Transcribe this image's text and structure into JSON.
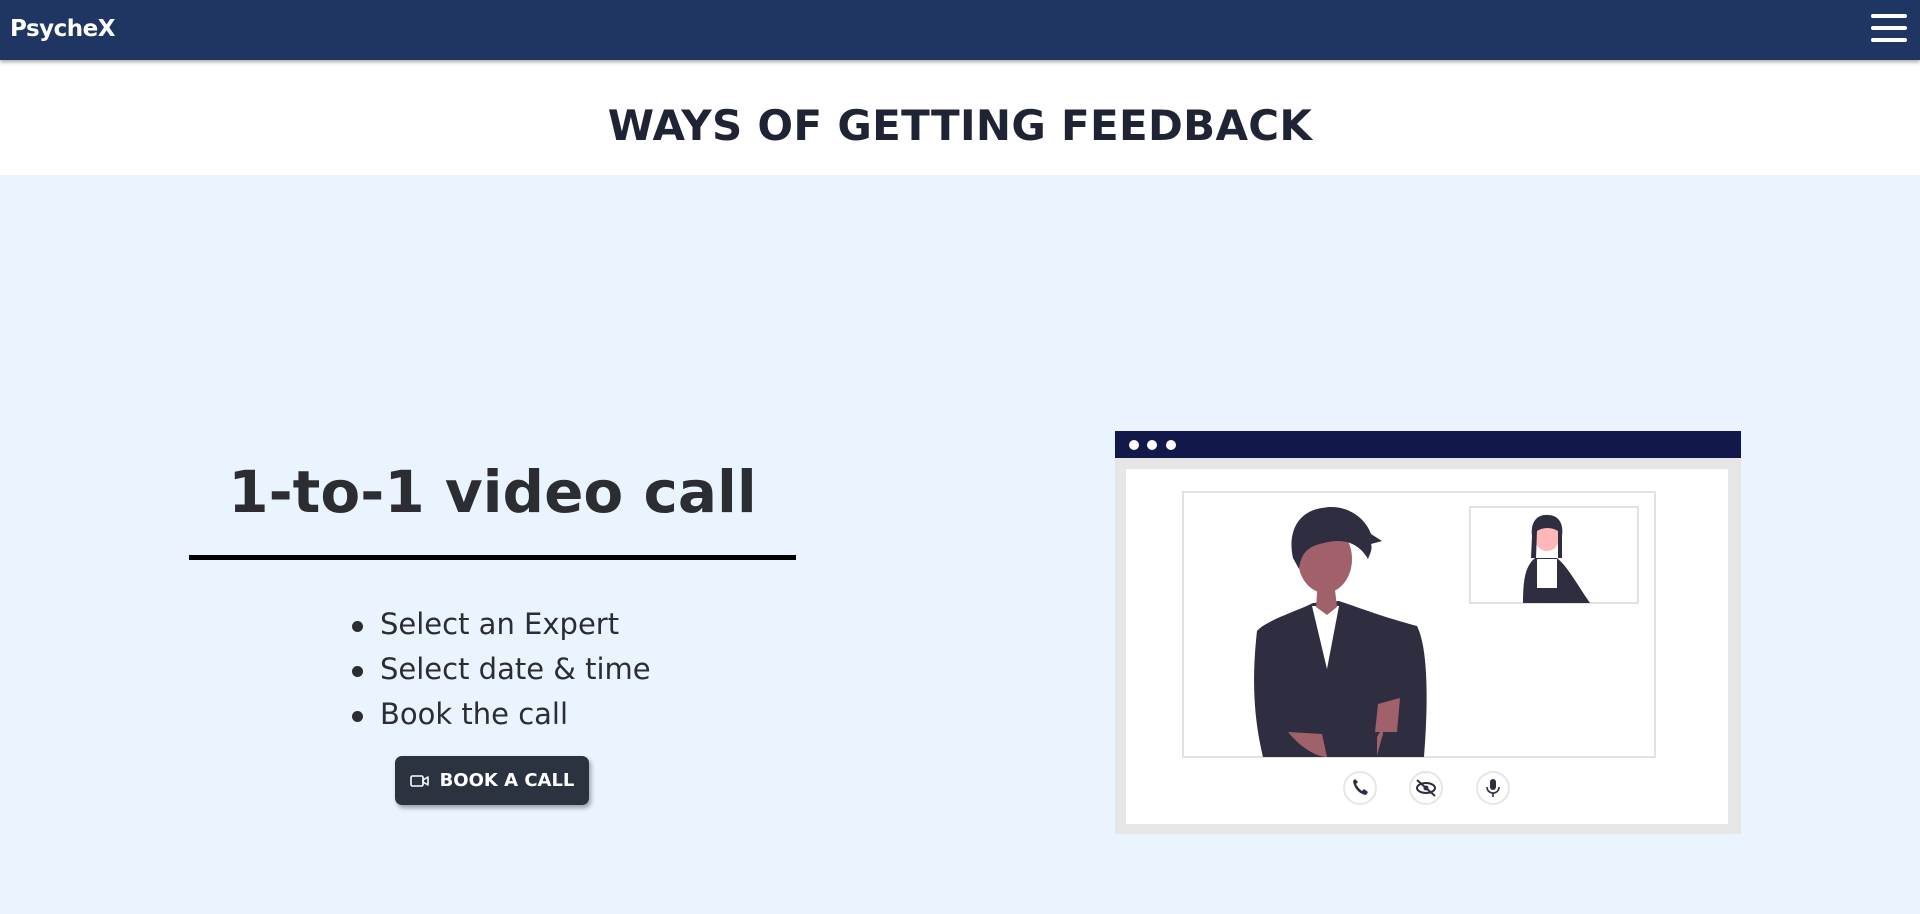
{
  "navbar": {
    "brand": "PsycheX",
    "menu_icon": "hamburger-menu-icon"
  },
  "section": {
    "title": "WAYS OF GETTING FEEDBACK"
  },
  "feature": {
    "title": "1-to-1 video call",
    "steps": [
      "Select an Expert",
      "Select date & time",
      "Book the call"
    ],
    "button": {
      "label": "BOOK A CALL",
      "icon": "video-camera-icon"
    }
  },
  "illustration": {
    "controls": [
      "phone-icon",
      "eye-off-icon",
      "microphone-icon"
    ]
  },
  "colors": {
    "navbar": "#1e3661",
    "hero_background": "#eaf4fe",
    "button": "#2b3240",
    "text_dark": "#2b2d33"
  }
}
